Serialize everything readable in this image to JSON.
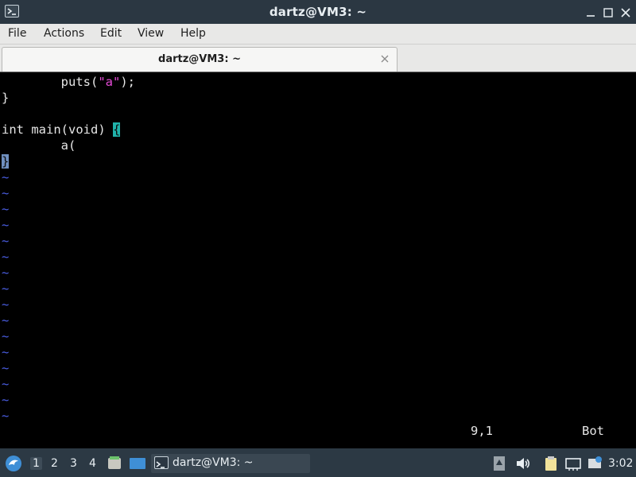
{
  "window": {
    "title": "dartz@VM3: ~"
  },
  "menu": [
    "File",
    "Actions",
    "Edit",
    "View",
    "Help"
  ],
  "tab": {
    "label": "dartz@VM3: ~"
  },
  "editor": {
    "line1_prefix": "        puts(",
    "line1_string": "\"a\"",
    "line1_suffix": ");",
    "line2": "}",
    "line4_text": "int main(void) ",
    "line4_brace": "{",
    "line5": "        a(",
    "line6_brace": "}",
    "tilde": "~",
    "status_position": "9,1",
    "status_scroll": "Bot"
  },
  "taskbar": {
    "workspaces": [
      "1",
      "2",
      "3",
      "4"
    ],
    "task_label": "dartz@VM3: ~",
    "clock": "3:02"
  },
  "colors": {
    "string": "#e64bd8",
    "cursor": "#20b2aa",
    "tilde": "#4b5fe6",
    "panel": "#2c3944"
  }
}
